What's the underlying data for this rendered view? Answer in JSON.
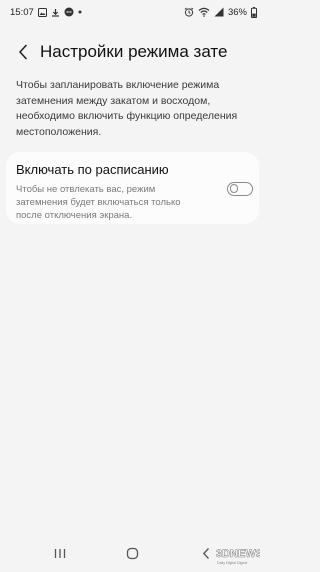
{
  "status_bar": {
    "time": "15:07",
    "battery": "36%",
    "left_icons": [
      "gallery-icon",
      "download-icon",
      "chat-icon"
    ],
    "right_icons": [
      "alarm-icon",
      "wifi-icon",
      "signal-icon",
      "battery-icon"
    ]
  },
  "header": {
    "title": "Настройки режима зате"
  },
  "description": "Чтобы запланировать включение режима затемнения между закатом и восходом, необходимо включить функцию определения местоположения.",
  "schedule_card": {
    "title": "Включать по расписанию",
    "subtitle": "Чтобы не отвлекать вас, режим затемнения будет включаться только после отключения экрана.",
    "toggle_on": false
  },
  "nav_bar": {
    "buttons": [
      "recents-button",
      "home-button",
      "back-button"
    ]
  },
  "watermark": {
    "text": "3DNEWS",
    "subtext": "Daily Digital Digest"
  },
  "colors": {
    "background": "#f4f4f4",
    "card": "#fcfcfc",
    "toggle_off": "#8a8a8a"
  }
}
